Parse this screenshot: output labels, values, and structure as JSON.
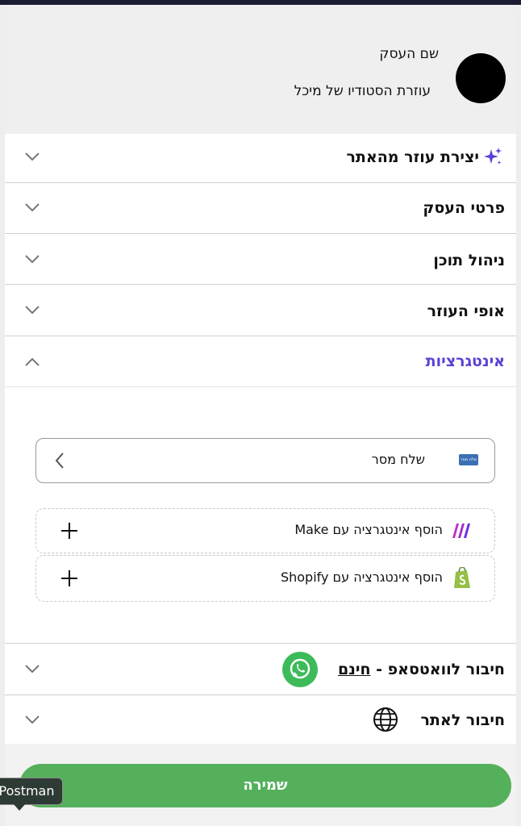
{
  "header": {
    "business_label": "שם העסק",
    "business_name": "עוזרת הסטודיו של מיכל"
  },
  "sections": {
    "create_assistant": "יצירת עוזר מהאתר",
    "business_details": "פרטי העסק",
    "content_management": "ניהול תוכן",
    "assistant_character": "אופי העוזר",
    "integrations": "אינטגרציות",
    "whatsapp_connect": "חיבור לוואטסאפ -",
    "whatsapp_free": "חינם",
    "site_connect": "חיבור לאתר"
  },
  "integrations": {
    "send_message": {
      "label": "שלח מסר",
      "logo_text": "שלח מסר",
      "icon": "sendmessage-logo"
    },
    "make": {
      "label": "הוסף אינטגרציה עם Make",
      "icon": "make-logo"
    },
    "shopify": {
      "label": "הוסף אינטגרציה עם Shopify",
      "icon": "shopify-logo"
    }
  },
  "save_button": "שמירה",
  "tooltip": "Postman",
  "colors": {
    "accent_purple": "#5b3fd6",
    "save_green": "#55b05b",
    "whatsapp_green": "#3dbb5a"
  }
}
